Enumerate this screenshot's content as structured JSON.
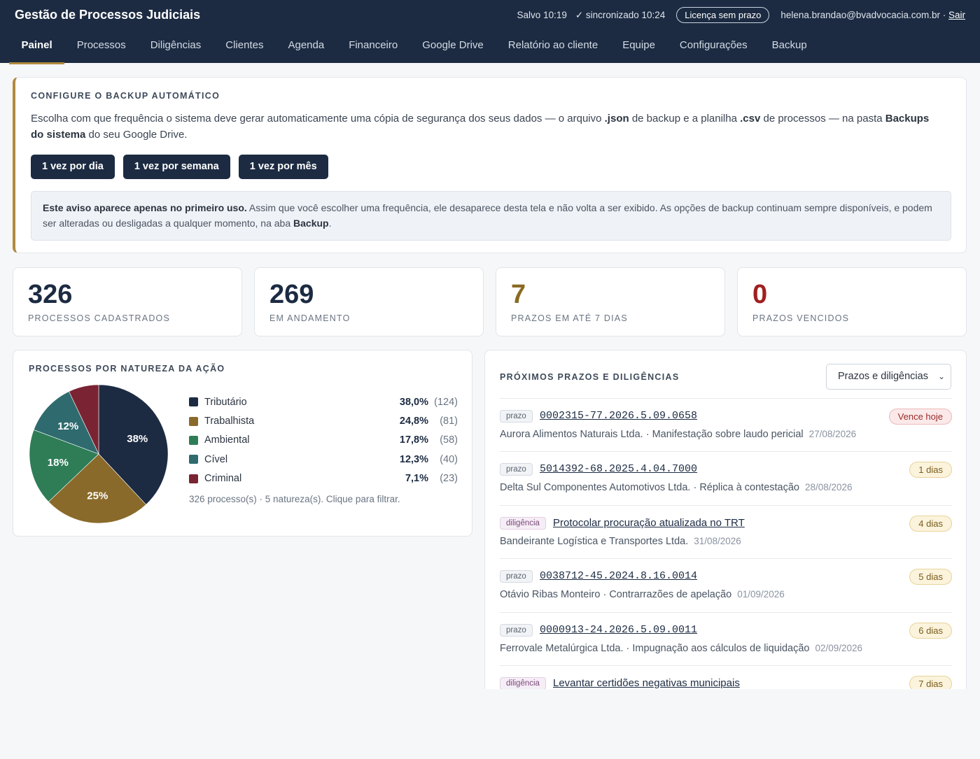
{
  "header": {
    "title": "Gestão de Processos Judiciais",
    "saved": "Salvo 10:19",
    "sync": "✓ sincronizado 10:24",
    "license": "Licença sem prazo",
    "user": "helena.brandao@bvadvocacia.com.br ·",
    "logout": "Sair"
  },
  "nav": {
    "tabs": [
      "Painel",
      "Processos",
      "Diligências",
      "Clientes",
      "Agenda",
      "Financeiro",
      "Google Drive",
      "Relatório ao cliente",
      "Equipe",
      "Configurações",
      "Backup"
    ],
    "active": "Painel"
  },
  "backup": {
    "title": "CONFIGURE O BACKUP AUTOMÁTICO",
    "desc_a": "Escolha com que frequência o sistema deve gerar automaticamente uma cópia de segurança dos seus dados — o arquivo ",
    "desc_json": ".json",
    "desc_b": " de backup e a planilha ",
    "desc_csv": ".csv",
    "desc_c": " de processos — na pasta ",
    "desc_folder": "Backups do sistema",
    "desc_d": " do seu Google Drive.",
    "buttons": [
      "1 vez por dia",
      "1 vez por semana",
      "1 vez por mês"
    ],
    "notice_bold": "Este aviso aparece apenas no primeiro uso.",
    "notice_text": " Assim que você escolher uma frequência, ele desaparece desta tela e não volta a ser exibido. As opções de backup continuam sempre disponíveis, e podem ser alteradas ou desligadas a qualquer momento, na aba ",
    "notice_tab": "Backup",
    "notice_end": "."
  },
  "stats": [
    {
      "value": "326",
      "label": "PROCESSOS CADASTRADOS",
      "color": "#1c2b42"
    },
    {
      "value": "269",
      "label": "EM ANDAMENTO",
      "color": "#1c2b42"
    },
    {
      "value": "7",
      "label": "PRAZOS EM ATÉ 7 DIAS",
      "color": "#8a6a22"
    },
    {
      "value": "0",
      "label": "PRAZOS VENCIDOS",
      "color": "#a0201f"
    }
  ],
  "chart_data": {
    "type": "pie",
    "title": "PROCESSOS POR NATUREZA DA AÇÃO",
    "slices": [
      {
        "name": "Tributário",
        "pct": "38,0%",
        "count": "(124)",
        "value": 124,
        "label": "38%",
        "color": "#1c2b42"
      },
      {
        "name": "Trabalhista",
        "pct": "24,8%",
        "count": "(81)",
        "value": 81,
        "label": "25%",
        "color": "#8a6a2a"
      },
      {
        "name": "Ambiental",
        "pct": "17,8%",
        "count": "(58)",
        "value": 58,
        "label": "18%",
        "color": "#2e7d57"
      },
      {
        "name": "Cível",
        "pct": "12,3%",
        "count": "(40)",
        "value": 40,
        "label": "12%",
        "color": "#2f6b6e"
      },
      {
        "name": "Criminal",
        "pct": "7,1%",
        "count": "(23)",
        "value": 23,
        "label": "",
        "color": "#7a2332"
      }
    ],
    "footer": "326 processo(s) · 5 natureza(s). Clique para filtrar."
  },
  "deadlines": {
    "title": "PRÓXIMOS PRAZOS E DILIGÊNCIAS",
    "filter": "Prazos e diligências",
    "items": [
      {
        "type": "prazo",
        "kind": "mono",
        "ref": "0002315-77.2026.5.09.0658",
        "party": "Aurora Alimentos Naturais Ltda. · Manifestação sobre laudo pericial",
        "date": "27/08/2026",
        "badge": "Vence hoje",
        "urgent": true
      },
      {
        "type": "prazo",
        "kind": "mono",
        "ref": "5014392-68.2025.4.04.7000",
        "party": "Delta Sul Componentes Automotivos Ltda. · Réplica à contestação",
        "date": "28/08/2026",
        "badge": "1 dias",
        "urgent": false
      },
      {
        "type": "diligência",
        "kind": "txt",
        "ref": "Protocolar procuração atualizada no TRT",
        "party": "Bandeirante Logística e Transportes Ltda.",
        "date": "31/08/2026",
        "badge": "4 dias",
        "urgent": false
      },
      {
        "type": "prazo",
        "kind": "mono",
        "ref": "0038712-45.2024.8.16.0014",
        "party": "Otávio Ribas Monteiro · Contrarrazões de apelação",
        "date": "01/09/2026",
        "badge": "5 dias",
        "urgent": false
      },
      {
        "type": "prazo",
        "kind": "mono",
        "ref": "0000913-24.2026.5.09.0011",
        "party": "Ferrovale Metalúrgica Ltda. · Impugnação aos cálculos de liquidação",
        "date": "02/09/2026",
        "badge": "6 dias",
        "urgent": false
      },
      {
        "type": "diligência",
        "kind": "txt",
        "ref": "Levantar certidões negativas municipais",
        "party": "",
        "date": "",
        "badge": "7 dias",
        "urgent": false
      }
    ]
  }
}
